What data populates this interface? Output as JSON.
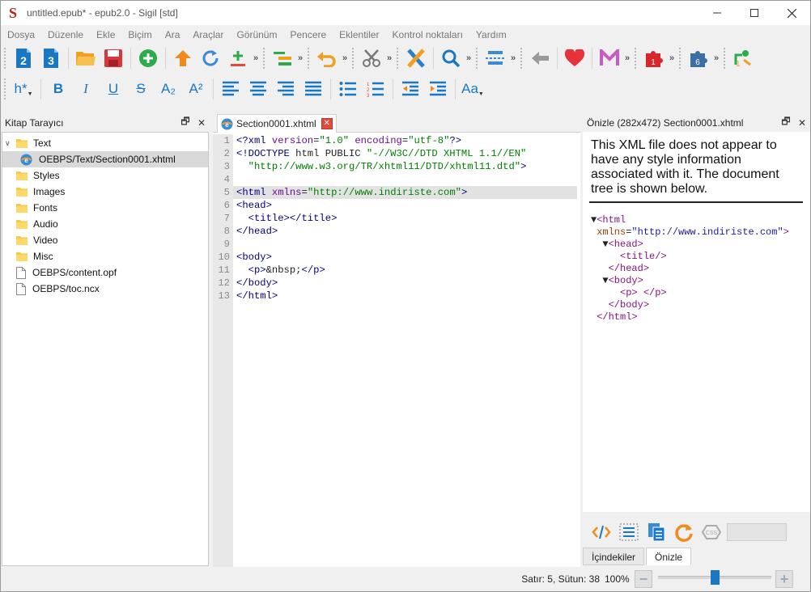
{
  "window": {
    "title": "untitled.epub* - epub2.0 - Sigil [std]",
    "logo_letter": "S",
    "controls": [
      "minimize",
      "maximize",
      "close"
    ]
  },
  "menu": [
    "Dosya",
    "Düzenle",
    "Ekle",
    "Biçim",
    "Ara",
    "Araçlar",
    "Görünüm",
    "Pencere",
    "Eklentiler",
    "Kontrol noktaları",
    "Yardım"
  ],
  "toolbar2": {
    "heading_label": "h*",
    "bold_label": "B",
    "italic_label": "I",
    "underline_label": "U",
    "strike_label": "S",
    "sub_label": "A₂",
    "sup_label": "A²",
    "case_label": "Aa"
  },
  "book_browser": {
    "title": "Kitap Tarayıcı",
    "items": [
      {
        "label": "Text",
        "type": "folder",
        "expanded": true
      },
      {
        "label": "OEBPS/Text/Section0001.xhtml",
        "type": "xhtml",
        "selected": true
      },
      {
        "label": "Styles",
        "type": "folder"
      },
      {
        "label": "Images",
        "type": "folder"
      },
      {
        "label": "Fonts",
        "type": "folder"
      },
      {
        "label": "Audio",
        "type": "folder"
      },
      {
        "label": "Video",
        "type": "folder"
      },
      {
        "label": "Misc",
        "type": "folder"
      },
      {
        "label": "OEBPS/content.opf",
        "type": "file"
      },
      {
        "label": "OEBPS/toc.ncx",
        "type": "file"
      }
    ]
  },
  "editor": {
    "tab_label": "Section0001.xhtml",
    "current_line": 5,
    "line_numbers": [
      "1",
      "2",
      "3",
      "4",
      "5",
      "6",
      "7",
      "8",
      "9",
      "10",
      "11",
      "12",
      "13"
    ],
    "lines": [
      "<?xml version=\"1.0\" encoding=\"utf-8\"?>",
      "<!DOCTYPE html PUBLIC \"-//W3C//DTD XHTML 1.1//EN\"",
      "  \"http://www.w3.org/TR/xhtml11/DTD/xhtml11.dtd\">",
      "",
      "<html xmlns=\"http://www.indiriste.com\">",
      "<head>",
      "  <title></title>",
      "</head>",
      "",
      "<body>",
      "  <p>&nbsp;</p>",
      "</body>",
      "</html>"
    ]
  },
  "preview": {
    "title": "Önizle (282x472) Section0001.xhtml",
    "message": "This XML file does not appear to have any style information associated with it. The document tree is shown below.",
    "tree": [
      "▼<html",
      " xmlns=\"http://www.indiriste.com\">",
      "  ▼<head>",
      "     <title/>",
      "   </head>",
      "  ▼<body>",
      "     <p> </p>",
      "   </body>",
      " </html>"
    ],
    "tabs": [
      "İçindekiler",
      "Önizle"
    ],
    "active_tab": "Önizle"
  },
  "status": {
    "position": "Satır: 5, Sütun: 38",
    "zoom": "100%",
    "zoom_fraction": 0.5
  },
  "colors": {
    "accent_blue": "#1a78c2",
    "tag_color": "#000080",
    "string_color": "#008000",
    "attr_color": "#6b0e8f",
    "close_red": "#e44a3a"
  }
}
